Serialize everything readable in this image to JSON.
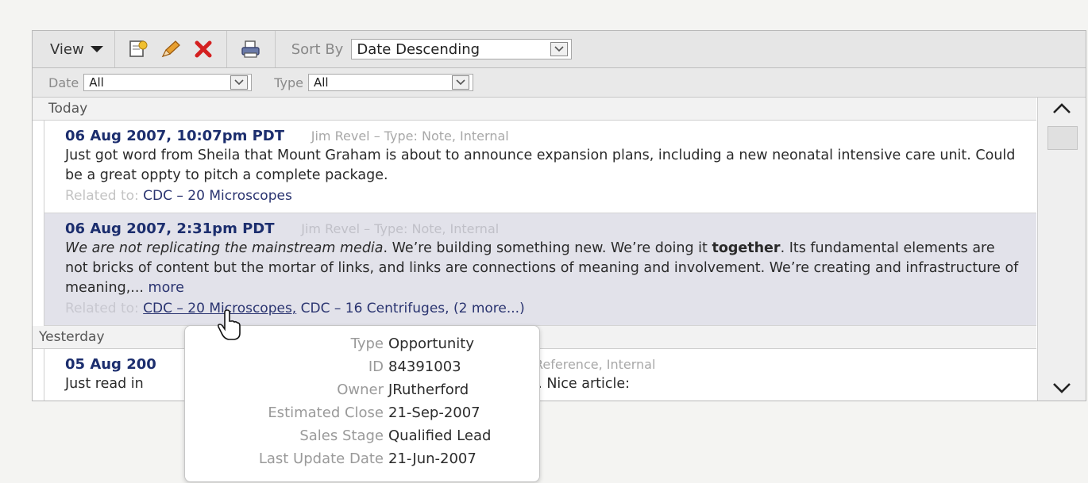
{
  "toolbar": {
    "view_label": "View",
    "icons": [
      "new-note-icon",
      "edit-pencil-icon",
      "delete-x-icon",
      "print-icon"
    ],
    "sort_label": "Sort By",
    "sort_value": "Date Descending"
  },
  "filters": {
    "date_label": "Date",
    "date_value": "All",
    "type_label": "Type",
    "type_value": "All"
  },
  "groups": {
    "today": "Today",
    "yesterday": "Yesterday"
  },
  "entries": [
    {
      "date": "06 Aug 2007, 10:07pm PDT",
      "meta": "Jim Revel – Type: Note, Internal",
      "body": "Just got word from Sheila that Mount Graham is about to announce expansion plans, including a new neonatal intensive care unit. Could be a great oppty to pitch a complete package.",
      "related_label": "Related to:",
      "related": "CDC – 20 Microscopes"
    },
    {
      "date": "06 Aug 2007, 2:31pm PDT",
      "meta": "Jim Revel – Type: Note, Internal",
      "body_italic": "We are not replicating the mainstream media",
      "body_part1": ". We’re building something new. We’re doing it ",
      "body_bold": "together",
      "body_part2": ". Its fundamental elements are not bricks of content but the mortar of links, and links are connections of meaning and involvement. We’re creating and infrastructure of meaning,...",
      "more_label": "more",
      "related_label": "Related to:",
      "related_1": "CDC – 20 Microscopes,",
      "related_2": "CDC – 16 Centrifuges,",
      "related_more": "(2 more...)"
    },
    {
      "date": "05 Aug 200",
      "meta": ": Reference, Internal",
      "body_start": "Just read in",
      "body_end": "SVP. Nice article:"
    }
  ],
  "popup": [
    {
      "key": "Type",
      "value": "Opportunity"
    },
    {
      "key": "ID",
      "value": "84391003"
    },
    {
      "key": "Owner",
      "value": "JRutherford"
    },
    {
      "key": "Estimated Close",
      "value": "21-Sep-2007"
    },
    {
      "key": "Sales Stage",
      "value": "Qualified Lead"
    },
    {
      "key": "Last Update Date",
      "value": "21-Jun-2007"
    }
  ],
  "colors": {
    "date_blue": "#1c2e6e",
    "link_blue": "#2a3470",
    "highlight_row": "#e2e2ea"
  }
}
